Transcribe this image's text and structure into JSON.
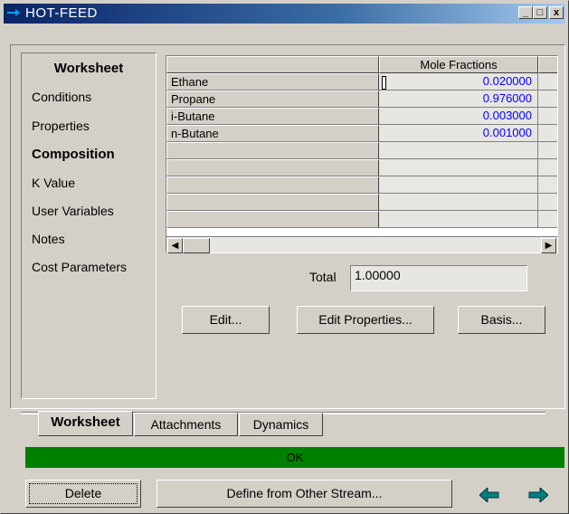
{
  "window": {
    "title": "HOT-FEED",
    "controls": {
      "minimize": "_",
      "maximize": "□",
      "close": "x"
    }
  },
  "sidebar": {
    "title": "Worksheet",
    "items": [
      {
        "label": "Conditions",
        "active": false
      },
      {
        "label": "Properties",
        "active": false
      },
      {
        "label": "Composition",
        "active": true
      },
      {
        "label": "K Value",
        "active": false
      },
      {
        "label": "User Variables",
        "active": false
      },
      {
        "label": "Notes",
        "active": false
      },
      {
        "label": "Cost Parameters",
        "active": false
      }
    ]
  },
  "composition_table": {
    "header": "Mole Fractions",
    "rows": [
      {
        "component": "Ethane",
        "value": "0.020000"
      },
      {
        "component": "Propane",
        "value": "0.976000"
      },
      {
        "component": "i-Butane",
        "value": "0.003000"
      },
      {
        "component": "n-Butane",
        "value": "0.001000"
      },
      {
        "component": "",
        "value": ""
      },
      {
        "component": "",
        "value": ""
      },
      {
        "component": "",
        "value": ""
      },
      {
        "component": "",
        "value": ""
      },
      {
        "component": "",
        "value": ""
      }
    ],
    "value_color": "#0000ff"
  },
  "total": {
    "label": "Total",
    "value": "1.00000"
  },
  "buttons": {
    "edit": "Edit...",
    "edit_properties": "Edit Properties...",
    "basis": "Basis..."
  },
  "tabs": [
    {
      "label": "Worksheet",
      "active": true
    },
    {
      "label": "Attachments",
      "active": false
    },
    {
      "label": "Dynamics",
      "active": false
    }
  ],
  "status": {
    "text": "OK",
    "color": "#008000"
  },
  "footer": {
    "delete": "Delete",
    "define": "Define from Other Stream...",
    "prev_icon": "left-arrow-icon",
    "next_icon": "right-arrow-icon",
    "arrow_color": "#008080"
  }
}
